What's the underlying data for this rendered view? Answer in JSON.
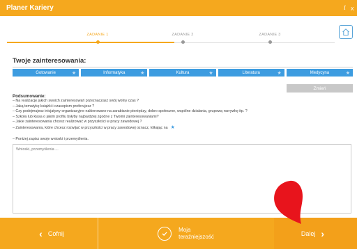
{
  "app": {
    "title": "Planer Kariery",
    "info_icon": "i",
    "close_icon": "x"
  },
  "steps": [
    {
      "label": "ZADANIE 1",
      "state": "active"
    },
    {
      "label": "ZADANIE 2",
      "state": "inactive"
    },
    {
      "label": "ZADANIE 3",
      "state": "inactive"
    }
  ],
  "section": {
    "title": "Twoje zainteresowania:"
  },
  "interests": [
    "Gotowanie",
    "Informatyka",
    "Kultura",
    "Literatura",
    "Medycyna"
  ],
  "change_button": "Zmień",
  "summary": {
    "title": "Podsumowanie:",
    "lines": [
      "– Na realizację jakich swoich zainteresowań przeznaczasz swój wolny czas ?",
      "– Jaką tematykę książki i czasopism preferujesz ?",
      "– Czy podejmujesz inicjatywy organizacyjne nakierowane na zarabianie pieniędzy, dobro społeczne, wspólne działania, grupową rozrywkę itp. ?",
      "– Szkoła lub klasa o jakim profilu byłyby najbardziej zgodne z Twoimi zainteresowaniami?",
      "– Jakie zainteresowania chcesz realizować w przyszłości w pracy zawodowej ?",
      "– Zainteresowania, które chcesz rozwijać w przyszłości w pracy zawodowej oznacz, klikając na"
    ],
    "notes_hint": "– Poniżej zapisz swoje wnioski i przemyślenia."
  },
  "notes": {
    "placeholder": "Wnioski, przemyślenia ..."
  },
  "footer": {
    "back": "Cofnij",
    "middle_line1": "Moja",
    "middle_line2": "teraźniejszość",
    "next": "Dalej"
  },
  "colors": {
    "accent": "#f5a81e",
    "chip": "#3d9ce0",
    "pin": "#e8141c"
  }
}
